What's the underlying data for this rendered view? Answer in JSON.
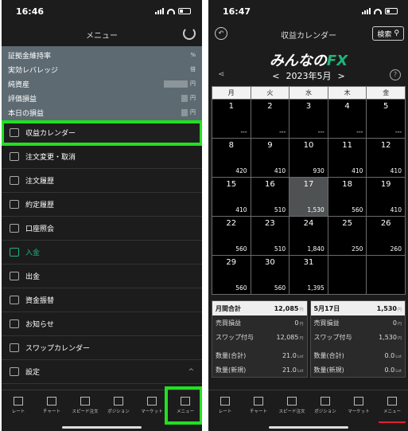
{
  "left": {
    "status_time": "16:46",
    "title": "メニュー",
    "summary": [
      {
        "label": "証拠金維持率",
        "unit": "%"
      },
      {
        "label": "実効レバレッジ",
        "unit": "倍"
      },
      {
        "label": "純資産",
        "unit": "円"
      },
      {
        "label": "評価損益",
        "unit": "円"
      },
      {
        "label": "本日の損益",
        "unit": "円"
      }
    ],
    "menu": [
      {
        "label": "収益カレンダー",
        "icon": "calendar-icon"
      },
      {
        "label": "注文変更・取消",
        "icon": "edit-icon"
      },
      {
        "label": "注文履歴",
        "icon": "folder-icon"
      },
      {
        "label": "約定履歴",
        "icon": "folder-icon"
      },
      {
        "label": "口座照会",
        "icon": "document-icon"
      },
      {
        "label": "入金",
        "icon": "deposit-icon"
      },
      {
        "label": "出金",
        "icon": "withdraw-icon"
      },
      {
        "label": "資金振替",
        "icon": "transfer-icon"
      },
      {
        "label": "お知らせ",
        "icon": "mail-icon"
      },
      {
        "label": "スワップカレンダー",
        "icon": "calendar-icon"
      },
      {
        "label": "設定",
        "icon": "gear-icon"
      }
    ],
    "chevron": "^"
  },
  "tabs": [
    {
      "label": "レート",
      "icon": "rate-icon"
    },
    {
      "label": "チャート",
      "icon": "chart-icon"
    },
    {
      "label": "スピード注文",
      "icon": "speed-order-icon"
    },
    {
      "label": "ポジション",
      "icon": "position-icon"
    },
    {
      "label": "マーケット",
      "icon": "market-icon"
    },
    {
      "label": "メニュー",
      "icon": "menu-icon"
    }
  ],
  "right": {
    "status_time": "16:47",
    "title": "収益カレンダー",
    "search_label": "検索",
    "logo_main": "みんなの",
    "logo_accent": "FX",
    "month_label": "2023年5月",
    "prev": "<",
    "next": ">",
    "help": "?",
    "weekdays": [
      "月",
      "火",
      "水",
      "木",
      "金"
    ],
    "days": [
      {
        "d": "1",
        "p": "---"
      },
      {
        "d": "2",
        "p": "---"
      },
      {
        "d": "3",
        "p": "---"
      },
      {
        "d": "4",
        "p": "---"
      },
      {
        "d": "5",
        "p": "---"
      },
      {
        "d": "8",
        "p": "420"
      },
      {
        "d": "9",
        "p": "410"
      },
      {
        "d": "10",
        "p": "930"
      },
      {
        "d": "11",
        "p": "410"
      },
      {
        "d": "12",
        "p": "410"
      },
      {
        "d": "15",
        "p": "410"
      },
      {
        "d": "16",
        "p": "510"
      },
      {
        "d": "17",
        "p": "1,530"
      },
      {
        "d": "18",
        "p": "560"
      },
      {
        "d": "19",
        "p": "410"
      },
      {
        "d": "22",
        "p": "560"
      },
      {
        "d": "23",
        "p": "510"
      },
      {
        "d": "24",
        "p": "1,840"
      },
      {
        "d": "25",
        "p": "250"
      },
      {
        "d": "26",
        "p": "260"
      },
      {
        "d": "29",
        "p": "560"
      },
      {
        "d": "30",
        "p": "560"
      },
      {
        "d": "31",
        "p": "1,395"
      },
      {
        "d": "",
        "p": ""
      },
      {
        "d": "",
        "p": ""
      }
    ],
    "monthly": {
      "title": "月間合計",
      "total": "12,085",
      "unit": "円",
      "rows": [
        {
          "label": "売買損益",
          "value": "0",
          "unit": "円"
        },
        {
          "label": "スワップ付与",
          "value": "12,085",
          "unit": "円"
        },
        {
          "label": "数量(合計)",
          "value": "21.0",
          "unit": "Lot"
        },
        {
          "label": "数量(新規)",
          "value": "21.0",
          "unit": "Lot"
        }
      ]
    },
    "daily": {
      "title": "5月17日",
      "total": "1,530",
      "unit": "円",
      "rows": [
        {
          "label": "売買損益",
          "value": "0",
          "unit": "円"
        },
        {
          "label": "スワップ付与",
          "value": "1,530",
          "unit": "円"
        },
        {
          "label": "数量(合計)",
          "value": "0.0",
          "unit": "Lot"
        },
        {
          "label": "数量(新規)",
          "value": "0.0",
          "unit": "Lot"
        }
      ]
    }
  }
}
